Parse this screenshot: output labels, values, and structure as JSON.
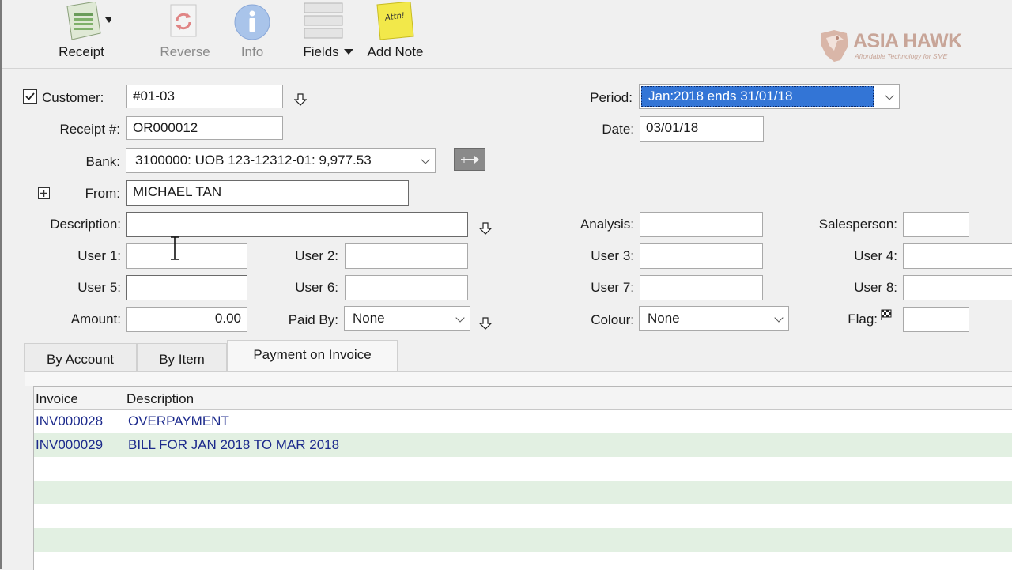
{
  "toolbar": {
    "receipt_label": "Receipt",
    "reverse_label": "Reverse",
    "info_label": "Info",
    "fields_label": "Fields",
    "add_note_label": "Add Note",
    "note_icon_text": "Attn!"
  },
  "logo": {
    "name": "ASIA HAWK",
    "tagline": "Affordable Technology for SME"
  },
  "form": {
    "customer_label": "Customer:",
    "customer_value": "#01-03",
    "customer_checked": true,
    "receipt_label": "Receipt #:",
    "receipt_value": "OR000012",
    "bank_label": "Bank:",
    "bank_value": "3100000: UOB 123-12312-01: 9,977.53",
    "from_label": "From:",
    "from_value": "MICHAEL TAN",
    "description_label": "Description:",
    "description_value": "",
    "period_label": "Period:",
    "period_value": "Jan:2018 ends 31/01/18",
    "date_label": "Date:",
    "date_value": "03/01/18",
    "analysis_label": "Analysis:",
    "analysis_value": "",
    "salesperson_label": "Salesperson:",
    "salesperson_value": "",
    "user1_label": "User 1:",
    "user2_label": "User 2:",
    "user3_label": "User 3:",
    "user4_label": "User 4:",
    "user5_label": "User 5:",
    "user6_label": "User 6:",
    "user7_label": "User 7:",
    "user8_label": "User 8:",
    "amount_label": "Amount:",
    "amount_value": "0.00",
    "paid_by_label": "Paid By:",
    "paid_by_value": "None",
    "colour_label": "Colour:",
    "colour_value": "None",
    "flag_label": "Flag:"
  },
  "tabs": [
    {
      "label": "By Account",
      "active": false
    },
    {
      "label": "By Item",
      "active": false
    },
    {
      "label": "Payment on Invoice",
      "active": true
    }
  ],
  "grid": {
    "columns": [
      "Invoice",
      "Description"
    ],
    "rows": [
      {
        "invoice": "INV000028",
        "description": "OVERPAYMENT"
      },
      {
        "invoice": "INV000029",
        "description": "BILL FOR JAN 2018 TO MAR 2018"
      }
    ]
  },
  "colors": {
    "selection": "#3375d6",
    "grid_alt_row": "#e2f0e2",
    "link_text": "#1c2a8c",
    "logo": "#c8a598"
  }
}
